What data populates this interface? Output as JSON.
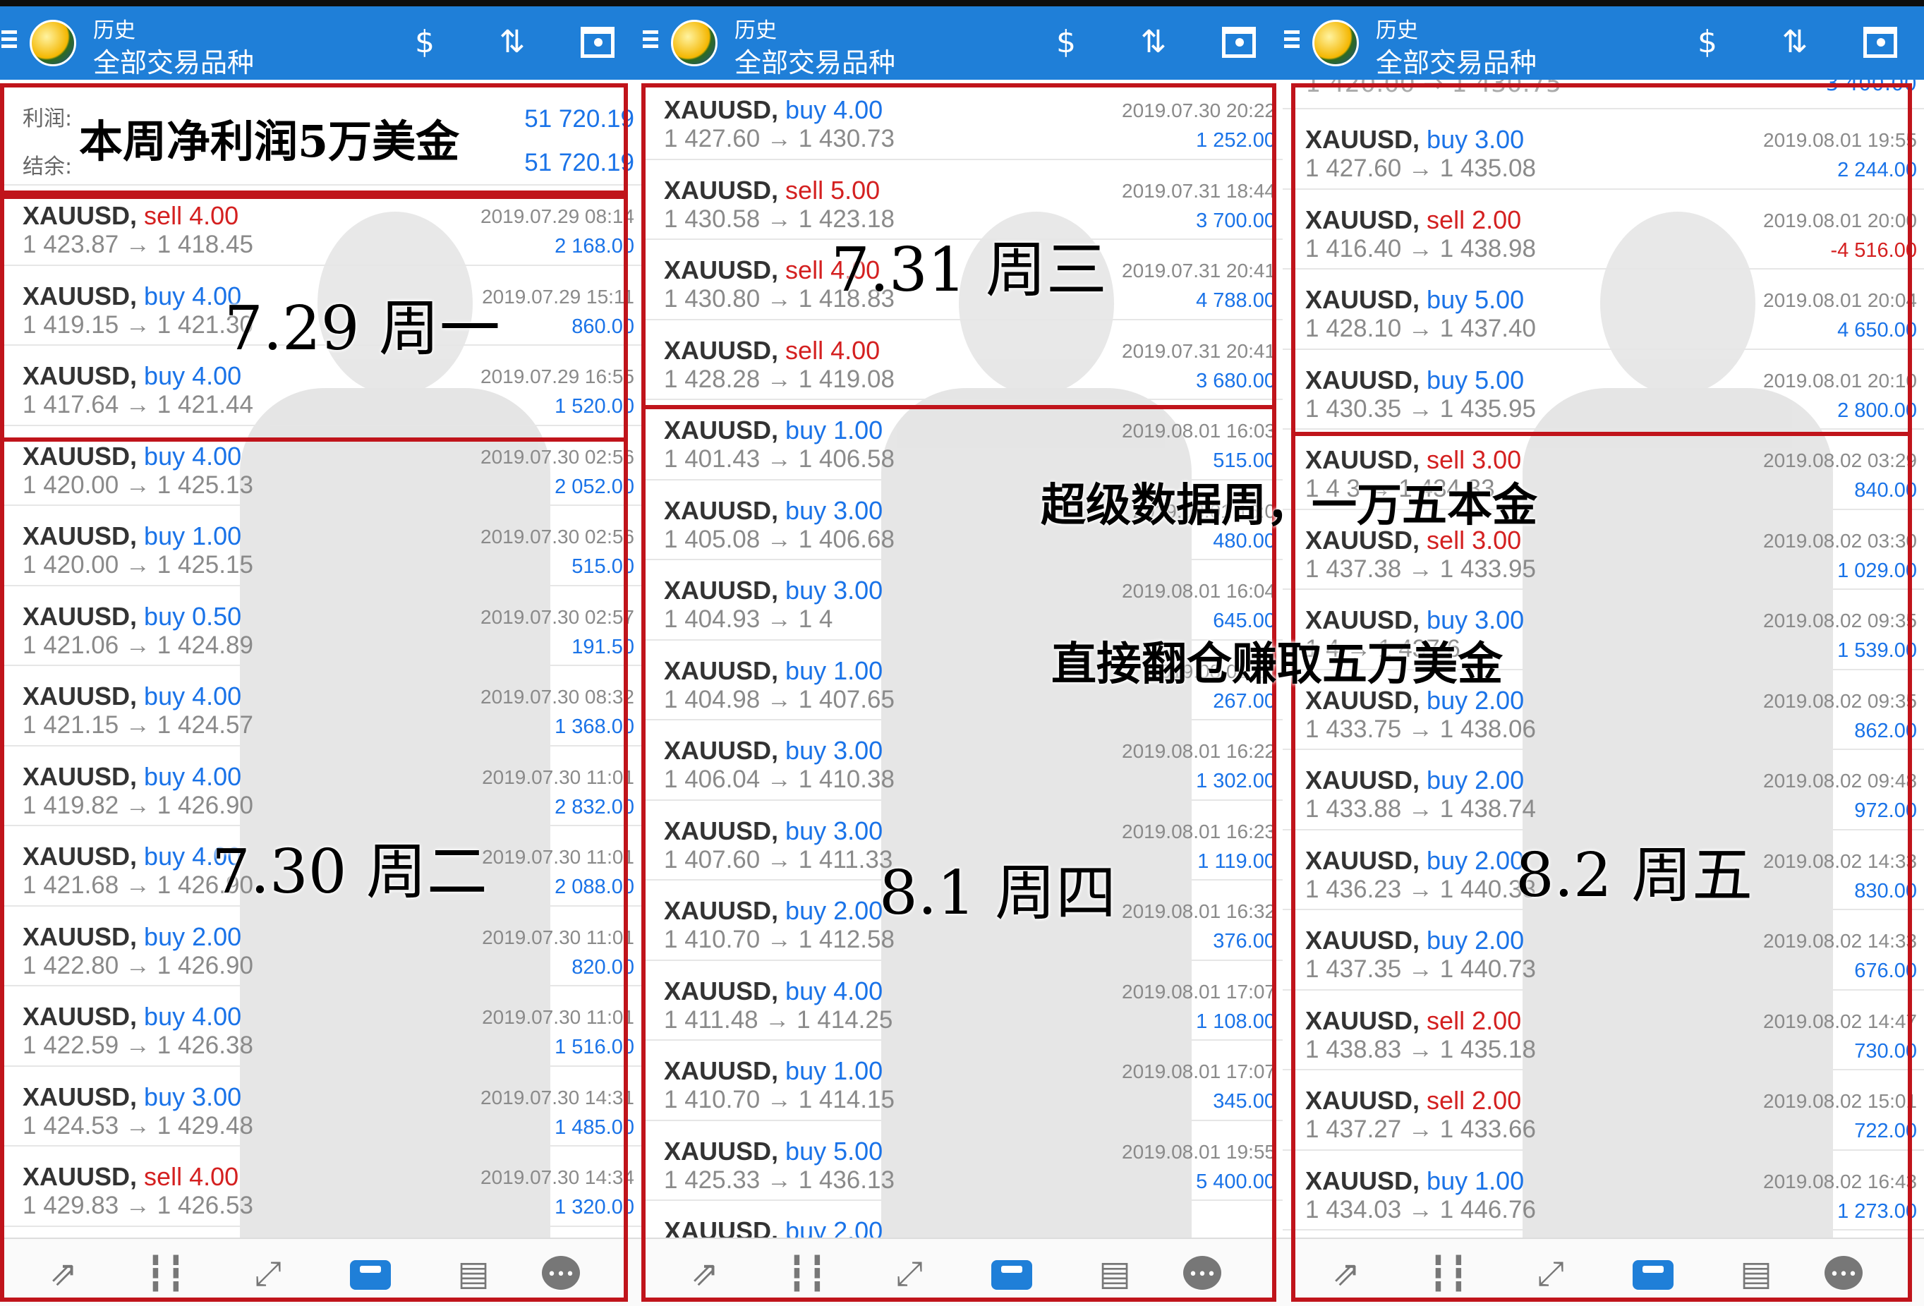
{
  "appbar": {
    "subtitle": "历史",
    "title": "全部交易品种",
    "icons": [
      "menu-icon",
      "metatrader-logo-icon",
      "currency-icon",
      "sort-icon",
      "calendar-icon"
    ]
  },
  "bottom_nav": {
    "icons": [
      "quotes-icon",
      "chart-candles-icon",
      "trade-icon",
      "history-icon",
      "news-icon",
      "chat-icon"
    ],
    "active": "history-icon"
  },
  "panel1": {
    "summary": {
      "profit_label": "利润:",
      "profit_value": "51 720.19",
      "balance_label": "结余:",
      "balance_value": "51 720.19"
    },
    "rows": [
      {
        "symbol": "XAUUSD,",
        "side": "sell",
        "lots": "4.00",
        "prices": "1 423.87 → 1 418.45",
        "time": "2019.07.29 08:14",
        "profit": "2 168.00"
      },
      {
        "symbol": "XAUUSD,",
        "side": "buy",
        "lots": "4.00",
        "prices": "1 419.15 → 1 421.30",
        "time": "2019.07.29 15:11",
        "profit": "860.00"
      },
      {
        "symbol": "XAUUSD,",
        "side": "buy",
        "lots": "4.00",
        "prices": "1 417.64 → 1 421.44",
        "time": "2019.07.29 16:55",
        "profit": "1 520.00"
      },
      {
        "symbol": "XAUUSD,",
        "side": "buy",
        "lots": "4.00",
        "prices": "1 420.00 → 1 425.13",
        "time": "2019.07.30 02:56",
        "profit": "2 052.00"
      },
      {
        "symbol": "XAUUSD,",
        "side": "buy",
        "lots": "1.00",
        "prices": "1 420.00 → 1 425.15",
        "time": "2019.07.30 02:56",
        "profit": "515.00"
      },
      {
        "symbol": "XAUUSD,",
        "side": "buy",
        "lots": "0.50",
        "prices": "1 421.06 → 1 424.89",
        "time": "2019.07.30 02:57",
        "profit": "191.50"
      },
      {
        "symbol": "XAUUSD,",
        "side": "buy",
        "lots": "4.00",
        "prices": "1 421.15 → 1 424.57",
        "time": "2019.07.30 08:32",
        "profit": "1 368.00"
      },
      {
        "symbol": "XAUUSD,",
        "side": "buy",
        "lots": "4.00",
        "prices": "1 419.82 → 1 426.90",
        "time": "2019.07.30 11:01",
        "profit": "2 832.00"
      },
      {
        "symbol": "XAUUSD,",
        "side": "buy",
        "lots": "4.00",
        "prices": "1 421.68 → 1 426.90",
        "time": "2019.07.30 11:01",
        "profit": "2 088.00"
      },
      {
        "symbol": "XAUUSD,",
        "side": "buy",
        "lots": "2.00",
        "prices": "1 422.80 → 1 426.90",
        "time": "2019.07.30 11:01",
        "profit": "820.00"
      },
      {
        "symbol": "XAUUSD,",
        "side": "buy",
        "lots": "4.00",
        "prices": "1 422.59 → 1 426.38",
        "time": "2019.07.30 11:01",
        "profit": "1 516.00"
      },
      {
        "symbol": "XAUUSD,",
        "side": "buy",
        "lots": "3.00",
        "prices": "1 424.53 → 1 429.48",
        "time": "2019.07.30 14:31",
        "profit": "1 485.00"
      },
      {
        "symbol": "XAUUSD,",
        "side": "sell",
        "lots": "4.00",
        "prices": "1 429.83 → 1 426.53",
        "time": "2019.07.30 14:34",
        "profit": "1 320.00"
      }
    ]
  },
  "panel2": {
    "rows": [
      {
        "symbol": "XAUUSD,",
        "side": "buy",
        "lots": "4.00",
        "prices": "1 427.60 → 1 430.73",
        "time": "2019.07.30 20:22",
        "profit": "1 252.00"
      },
      {
        "symbol": "XAUUSD,",
        "side": "sell",
        "lots": "5.00",
        "prices": "1 430.58 → 1 423.18",
        "time": "2019.07.31 18:44",
        "profit": "3 700.00"
      },
      {
        "symbol": "XAUUSD,",
        "side": "sell",
        "lots": "4.00",
        "prices": "1 430.80 → 1 418.83",
        "time": "2019.07.31 20:41",
        "profit": "4 788.00"
      },
      {
        "symbol": "XAUUSD,",
        "side": "sell",
        "lots": "4.00",
        "prices": "1 428.28 → 1 419.08",
        "time": "2019.07.31 20:41",
        "profit": "3 680.00"
      },
      {
        "symbol": "XAUUSD,",
        "side": "buy",
        "lots": "1.00",
        "prices": "1 401.43 → 1 406.58",
        "time": "2019.08.01 16:03",
        "profit": "515.00"
      },
      {
        "symbol": "XAUUSD,",
        "side": "buy",
        "lots": "3.00",
        "prices": "1 405.08 → 1 406.68",
        "time": "2019.08.01 16:0",
        "profit": "480.00"
      },
      {
        "symbol": "XAUUSD,",
        "side": "buy",
        "lots": "3.00",
        "prices": "1 404.93 → 1 4",
        "time": "2019.08.01 16:04",
        "profit": "645.00"
      },
      {
        "symbol": "XAUUSD,",
        "side": "buy",
        "lots": "1.00",
        "prices": "1 404.98 → 1 407.65",
        "time": "2019.08.01 16",
        "profit": "267.00"
      },
      {
        "symbol": "XAUUSD,",
        "side": "buy",
        "lots": "3.00",
        "prices": "1 406.04 → 1 410.38",
        "time": "2019.08.01 16:22",
        "profit": "1 302.00"
      },
      {
        "symbol": "XAUUSD,",
        "side": "buy",
        "lots": "3.00",
        "prices": "1 407.60 → 1 411.33",
        "time": "2019.08.01 16:23",
        "profit": "1 119.00"
      },
      {
        "symbol": "XAUUSD,",
        "side": "buy",
        "lots": "2.00",
        "prices": "1 410.70 → 1 412.58",
        "time": "2019.08.01 16:32",
        "profit": "376.00"
      },
      {
        "symbol": "XAUUSD,",
        "side": "buy",
        "lots": "4.00",
        "prices": "1 411.48 → 1 414.25",
        "time": "2019.08.01 17:07",
        "profit": "1 108.00"
      },
      {
        "symbol": "XAUUSD,",
        "side": "buy",
        "lots": "1.00",
        "prices": "1 410.70 → 1 414.15",
        "time": "2019.08.01 17:07",
        "profit": "345.00"
      },
      {
        "symbol": "XAUUSD,",
        "side": "buy",
        "lots": "5.00",
        "prices": "1 425.33 → 1 436.13",
        "time": "2019.08.01 19:55",
        "profit": "5 400.00"
      },
      {
        "symbol": "XAUUSD,",
        "side": "buy",
        "lots": "2.00",
        "prices": "",
        "time": "",
        "profit": ""
      }
    ]
  },
  "panel3": {
    "partial_top": {
      "prices": "1 420.00 → 1 430.75",
      "profit": "3 400.00"
    },
    "rows": [
      {
        "symbol": "XAUUSD,",
        "side": "buy",
        "lots": "3.00",
        "prices": "1 427.60 → 1 435.08",
        "time": "2019.08.01 19:55",
        "profit": "2 244.00"
      },
      {
        "symbol": "XAUUSD,",
        "side": "sell",
        "lots": "2.00",
        "prices": "1 416.40 → 1 438.98",
        "time": "2019.08.01 20:00",
        "profit": "-4 516.00"
      },
      {
        "symbol": "XAUUSD,",
        "side": "buy",
        "lots": "5.00",
        "prices": "1 428.10 → 1 437.40",
        "time": "2019.08.01 20:04",
        "profit": "4 650.00"
      },
      {
        "symbol": "XAUUSD,",
        "side": "buy",
        "lots": "5.00",
        "prices": "1 430.35 → 1 435.95",
        "time": "2019.08.01 20:10",
        "profit": "2 800.00"
      },
      {
        "symbol": "XAUUSD,",
        "side": "sell",
        "lots": "3.00",
        "prices": "1 4 3 → 1 434.33",
        "time": "2019.08.02 03:29",
        "profit": "840.00"
      },
      {
        "symbol": "XAUUSD,",
        "side": "sell",
        "lots": "3.00",
        "prices": "1 437.38 → 1 433.95",
        "time": "2019.08.02 03:30",
        "profit": "1 029.00"
      },
      {
        "symbol": "XAUUSD,",
        "side": "buy",
        "lots": "3.00",
        "prices": "1 4 → 1 437.6",
        "time": "2019.08.02 09:35",
        "profit": "1 539.00"
      },
      {
        "symbol": "XAUUSD,",
        "side": "buy",
        "lots": "2.00",
        "prices": "1 433.75 → 1 438.06",
        "time": "2019.08.02 09:35",
        "profit": "862.00"
      },
      {
        "symbol": "XAUUSD,",
        "side": "buy",
        "lots": "2.00",
        "prices": "1 433.88 → 1 438.74",
        "time": "2019.08.02 09:48",
        "profit": "972.00"
      },
      {
        "symbol": "XAUUSD,",
        "side": "buy",
        "lots": "2.00",
        "prices": "1 436.23 → 1 440.38",
        "time": "2019.08.02 14:33",
        "profit": "830.00"
      },
      {
        "symbol": "XAUUSD,",
        "side": "buy",
        "lots": "2.00",
        "prices": "1 437.35 → 1 440.73",
        "time": "2019.08.02 14:33",
        "profit": "676.00"
      },
      {
        "symbol": "XAUUSD,",
        "side": "sell",
        "lots": "2.00",
        "prices": "1 438.83 → 1 435.18",
        "time": "2019.08.02 14:47",
        "profit": "730.00"
      },
      {
        "symbol": "XAUUSD,",
        "side": "sell",
        "lots": "2.00",
        "prices": "1 437.27 → 1 433.66",
        "time": "2019.08.02 15:01",
        "profit": "722.00"
      },
      {
        "symbol": "XAUUSD,",
        "side": "buy",
        "lots": "1.00",
        "prices": "1 434.03 → 1 446.76",
        "time": "2019.08.02 16:43",
        "profit": "1 273.00"
      }
    ]
  },
  "annotations": {
    "week_profit": "本周净利润5万美金",
    "day_mon": "7.29 周一",
    "day_tue": "7.30 周二",
    "day_wed": "7.31 周三",
    "day_thu": "8.1 周四",
    "day_fri": "8.2 周五",
    "caption1": "超级数据周，一万五本金",
    "caption2": "直接翻仓赚取五万美金"
  },
  "colors": {
    "appbar": "#1f7fd8",
    "buy": "#1a73e8",
    "sell": "#d42020",
    "box": "#c0141b"
  }
}
